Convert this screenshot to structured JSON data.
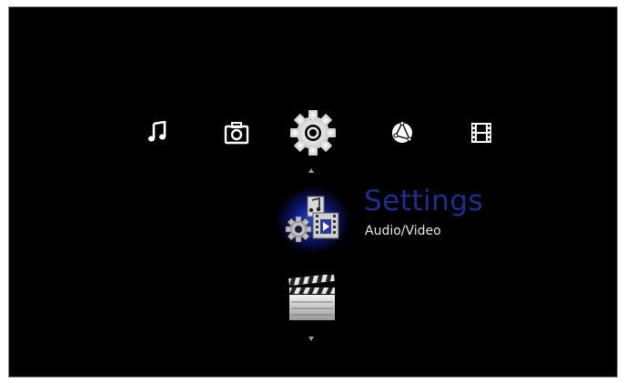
{
  "menu": {
    "categories": [
      {
        "name": "music",
        "icon": "music-note-icon",
        "selected": false
      },
      {
        "name": "photo",
        "icon": "camera-icon",
        "selected": false
      },
      {
        "name": "settings",
        "icon": "gear-icon",
        "selected": true
      },
      {
        "name": "internet",
        "icon": "globe-icon",
        "selected": false
      },
      {
        "name": "video",
        "icon": "film-strip-icon",
        "selected": false
      }
    ]
  },
  "selected_entry": {
    "title": "Settings",
    "subtitle": "Audio/Video",
    "icon": "audio-video-settings-icon"
  },
  "next_entry": {
    "icon": "clapperboard-icon"
  },
  "colors": {
    "background": "#000000",
    "title": "#1c2f8f",
    "subtitle": "#e6e6e6",
    "glow": "#2850ff",
    "icon": "#ffffff"
  }
}
